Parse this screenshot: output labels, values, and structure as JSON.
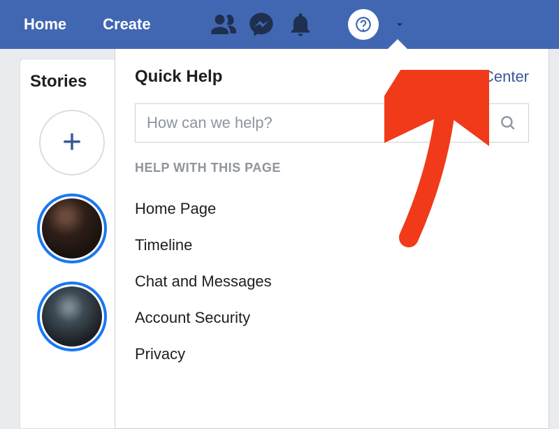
{
  "topbar": {
    "home_label": "Home",
    "create_label": "Create"
  },
  "stories": {
    "title": "Stories"
  },
  "help": {
    "quick_help_title": "Quick Help",
    "help_center_label": "Help Center",
    "search_placeholder": "How can we help?",
    "section_header": "HELP WITH THIS PAGE",
    "items": [
      "Home Page",
      "Timeline",
      "Chat and Messages",
      "Account Security",
      "Privacy"
    ]
  }
}
